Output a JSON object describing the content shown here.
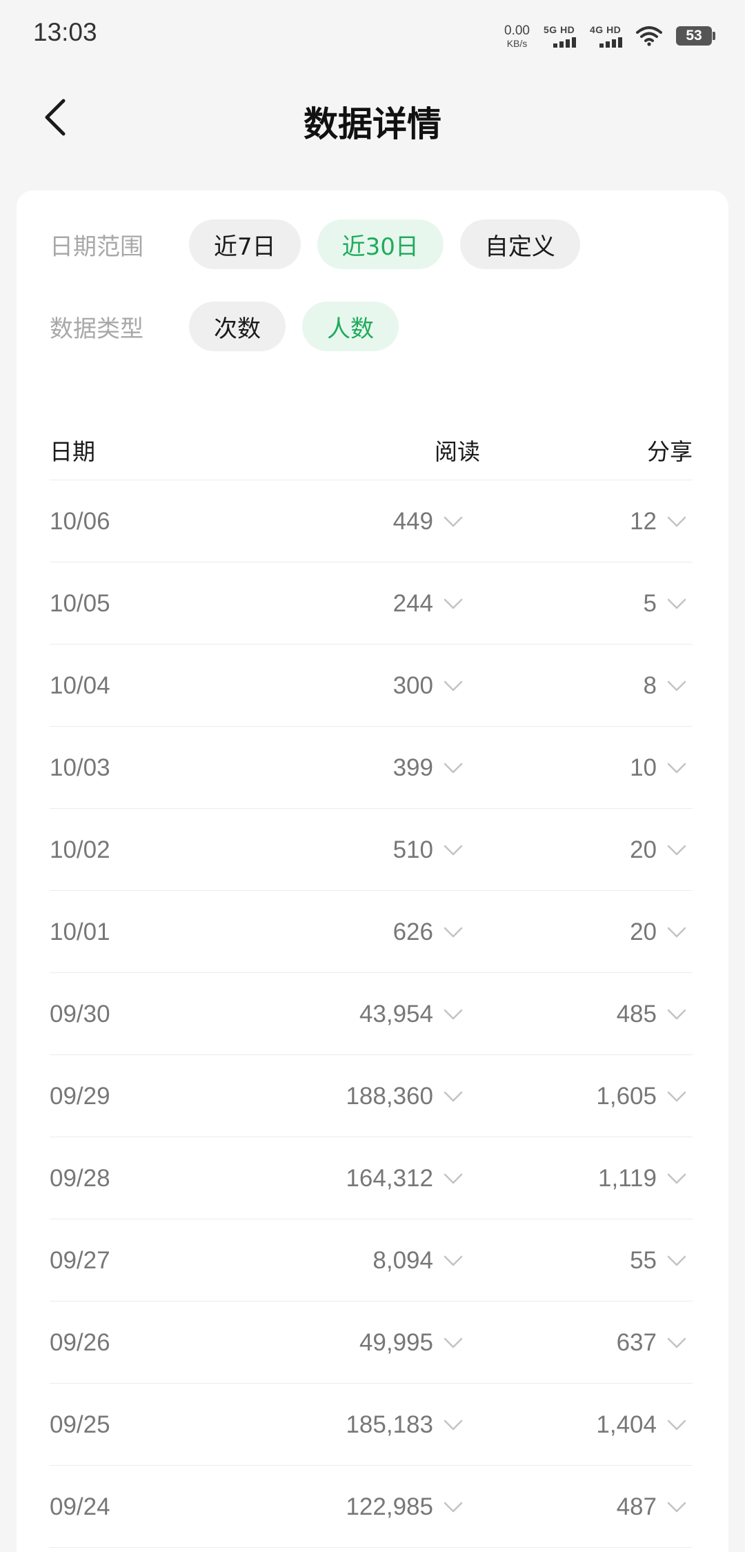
{
  "status_bar": {
    "time": "13:03",
    "net_speed_value": "0.00",
    "net_speed_unit": "KB/s",
    "signal_1_label": "5G HD",
    "signal_2_label": "4G HD",
    "battery": "53",
    "icons": [
      "wifi-icon",
      "signal-icon",
      "battery-icon"
    ]
  },
  "nav": {
    "back_icon": "chevron-left-icon",
    "title": "数据详情"
  },
  "filters": {
    "date_range": {
      "label": "日期范围",
      "options": [
        "近7日",
        "近30日",
        "自定义"
      ],
      "selected": "近30日"
    },
    "data_type": {
      "label": "数据类型",
      "options": [
        "次数",
        "人数"
      ],
      "selected": "人数"
    }
  },
  "colors": {
    "accent": "#1fab5c",
    "accent_bg": "#e8f7ee",
    "chip_bg": "#efefef"
  },
  "table": {
    "headers": {
      "date": "日期",
      "read": "阅读",
      "share": "分享"
    },
    "rows": [
      {
        "date": "10/06",
        "read": "449",
        "share": "12"
      },
      {
        "date": "10/05",
        "read": "244",
        "share": "5"
      },
      {
        "date": "10/04",
        "read": "300",
        "share": "8"
      },
      {
        "date": "10/03",
        "read": "399",
        "share": "10"
      },
      {
        "date": "10/02",
        "read": "510",
        "share": "20"
      },
      {
        "date": "10/01",
        "read": "626",
        "share": "20"
      },
      {
        "date": "09/30",
        "read": "43,954",
        "share": "485"
      },
      {
        "date": "09/29",
        "read": "188,360",
        "share": "1,605"
      },
      {
        "date": "09/28",
        "read": "164,312",
        "share": "1,119"
      },
      {
        "date": "09/27",
        "read": "8,094",
        "share": "55"
      },
      {
        "date": "09/26",
        "read": "49,995",
        "share": "637"
      },
      {
        "date": "09/25",
        "read": "185,183",
        "share": "1,404"
      },
      {
        "date": "09/24",
        "read": "122,985",
        "share": "487"
      }
    ]
  }
}
